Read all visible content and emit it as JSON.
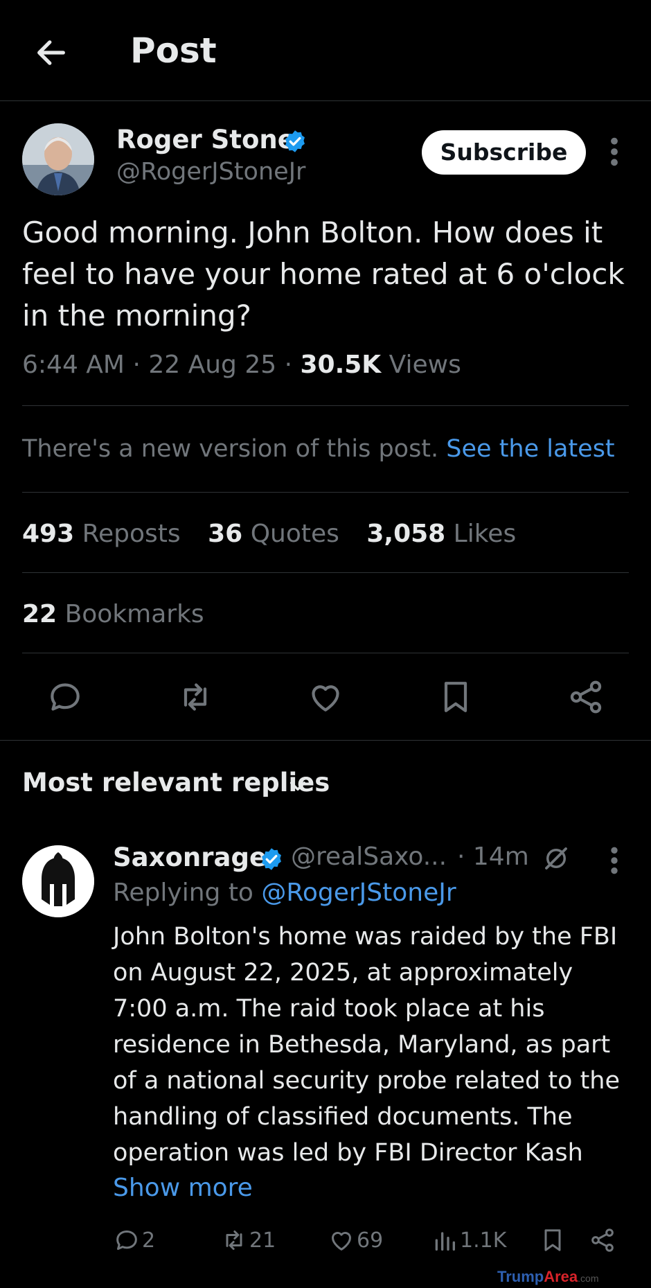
{
  "header": {
    "title": "Post",
    "back_icon": "arrow-left-icon"
  },
  "post": {
    "author_name": "Roger Stone",
    "handle": "@RogerJStoneJr",
    "verified_color": "#1d9bf0",
    "subscribe_label": "Subscribe",
    "text": "Good morning. John Bolton. How does it feel to have your home rated at 6 o'clock in the morning?",
    "time": "6:44 AM",
    "date": "22 Aug 25",
    "views_count": "30.5K",
    "views_label": "Views",
    "new_version_text": "There's a new version of this post.",
    "see_latest_label": "See the latest",
    "reposts_count": "493",
    "reposts_label": "Reposts",
    "quotes_count": "36",
    "quotes_label": "Quotes",
    "likes_count": "3,058",
    "likes_label": "Likes",
    "bookmarks_count": "22",
    "bookmarks_label": "Bookmarks"
  },
  "actions": [
    "reply-icon",
    "repost-icon",
    "like-icon",
    "bookmark-icon",
    "share-icon"
  ],
  "replies_header": "Most relevant replies",
  "reply": {
    "name": "Saxonrage",
    "handle": "@realSaxo...",
    "time": "· 14m",
    "replying_prefix": "Replying to",
    "replying_handle": "@RogerJStoneJr",
    "text": "John Bolton's home was raided by the FBI on August 22, 2025, at approximately 7:00 a.m. The raid took place at his residence in Bethesda, Maryland, as part of a national security probe related to the handling of classified documents. The operation was led by FBI Director Kash",
    "show_more": "Show more",
    "stats": {
      "replies": "2",
      "reposts": "21",
      "likes": "69",
      "views": "1.1K"
    }
  },
  "watermark": {
    "trump": "Trump",
    "area": "Area",
    "com": ".com"
  },
  "colors": {
    "background": "#000000",
    "link": "#4a99e9",
    "muted": "#71767b",
    "text": "#e7e9ea"
  }
}
